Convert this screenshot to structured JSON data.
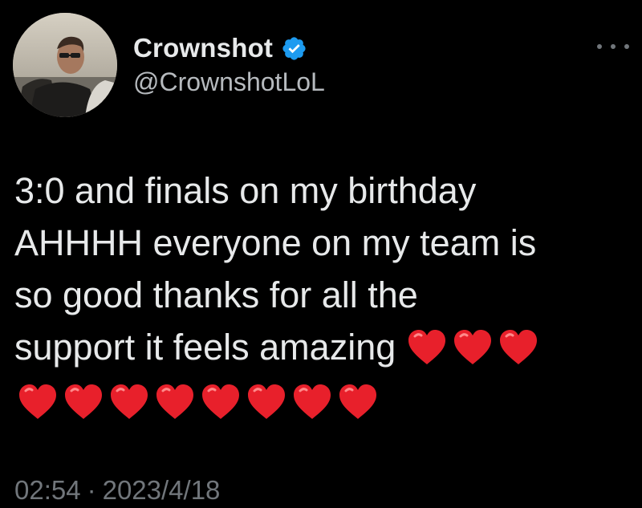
{
  "author": {
    "display_name": "Crownshot",
    "handle": "@CrownshotLoL",
    "verified": true
  },
  "tweet": {
    "text": "3:0 and finals on my birthday\nAHHHH everyone on my team is\nso good thanks for all the\nsupport it feels amazing",
    "inline_emoji": "❤️",
    "inline_emoji_count": 3,
    "trailing_emoji_count": 8
  },
  "meta": {
    "time": "02:54",
    "separator": "·",
    "date": "2023/4/18"
  },
  "icons": {
    "more": "more-horizontal-icon",
    "verified": "verified-badge-icon",
    "heart": "red-heart-emoji"
  },
  "colors": {
    "background": "#000000",
    "primary_text": "#e7e9ea",
    "secondary_text": "#71767b",
    "verified_blue": "#1d9bf0",
    "heart_red": "#e8202b"
  }
}
